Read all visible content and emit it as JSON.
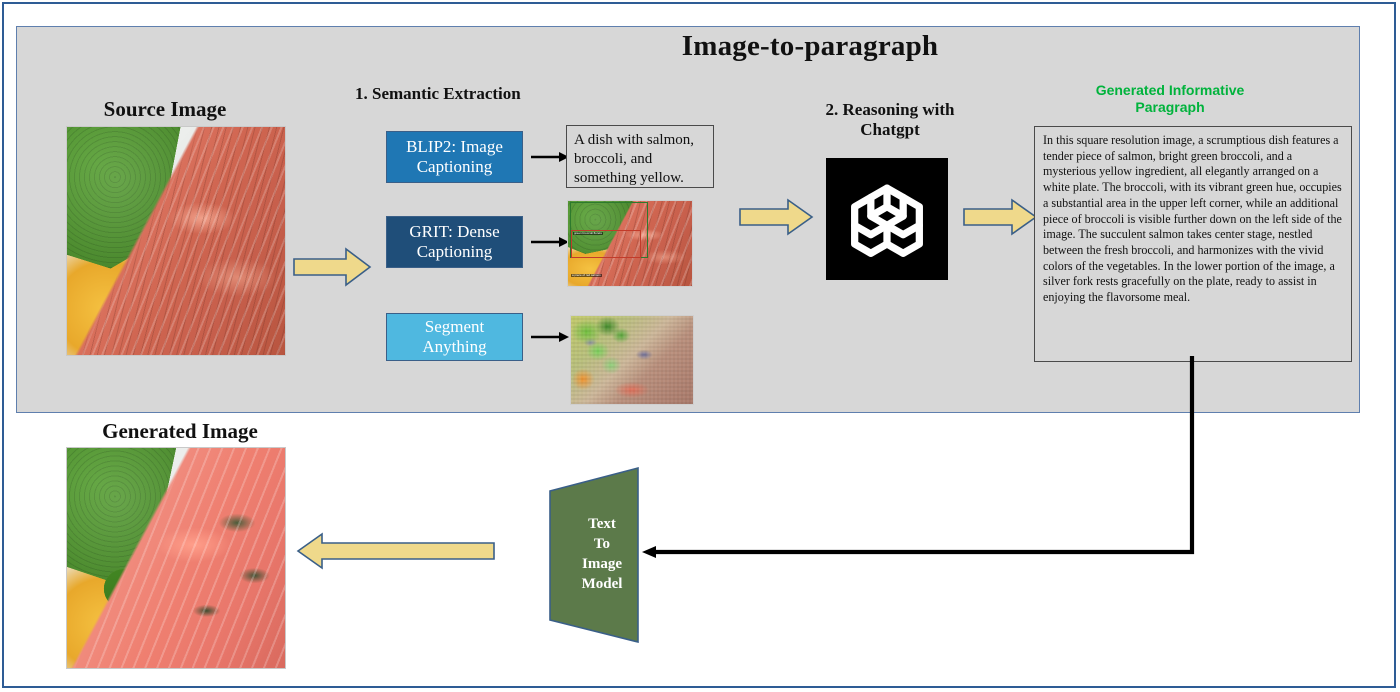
{
  "figure": {
    "title": "Image-to-paragraph",
    "outline_color": "#2e5c95",
    "panel_color": "#d7d7d7"
  },
  "labels": {
    "source_image": "Source Image",
    "generated_image": "Generated Image",
    "step1": "1. Semantic Extraction",
    "step2": "2. Reasoning with\nChatgpt",
    "step2_line1": "2. Reasoning with",
    "step2_line2": "Chatgpt",
    "generated_paragraph_heading": "Generated Informative\nParagraph",
    "generated_paragraph_heading_line1": "Generated Informative",
    "generated_paragraph_heading_line2": "Paragraph",
    "generated_paragraph_heading_color": "#00b33c"
  },
  "modules": [
    {
      "id": "blip2",
      "label": "BLIP2: Image\nCaptioning",
      "line1": "BLIP2: Image",
      "line2": "Captioning",
      "color": "#1f77b4"
    },
    {
      "id": "grit",
      "label": "GRIT: Dense\nCaptioning",
      "line1": "GRIT: Dense",
      "line2": "Captioning",
      "color": "#1f4e79"
    },
    {
      "id": "sam",
      "label": "Segment\nAnything",
      "line1": "Segment",
      "line2": "Anything",
      "color": "#4fb8e0"
    }
  ],
  "outputs": {
    "blip2_caption": "A dish with salmon, broccoli, and something yellow.",
    "grit_boxes": [
      {
        "label": "green broccoli florets",
        "color": "#2d7a2d"
      },
      {
        "label": "a piece of red salmon",
        "color": "#c23b2a"
      }
    ]
  },
  "chatgpt": {
    "logo_name": "openai-logo",
    "background": "#000000",
    "mark_color": "#ffffff"
  },
  "paragraph": {
    "text": "In this square resolution image, a scrumptious dish features a tender piece of salmon, bright green broccoli, and a mysterious yellow ingredient, all elegantly arranged on a white plate. The broccoli, with its vibrant green hue, occupies a substantial area in the upper left corner, while an additional piece of broccoli is visible further down on the left side of the image. The succulent salmon takes center stage, nestled between the fresh broccoli, and harmonizes with the vivid colors of the vegetables. In the lower portion of the image, a silver fork rests gracefully on the plate, ready to assist in enjoying the flavorsome meal."
  },
  "text_to_image_model": {
    "lines": [
      "Text",
      "To",
      "Image",
      "Model"
    ],
    "line1": "Text",
    "line2": "To",
    "line3": "Image",
    "line4": "Model",
    "color": "#5c7a4a"
  },
  "arrows": {
    "yellow_fill": "#efd98b",
    "yellow_stroke": "#3a5f88",
    "black": "#000000",
    "names": [
      "source-to-modules-arrow",
      "extraction-to-chatgpt-arrow",
      "chatgpt-to-paragraph-arrow",
      "model-to-generated-arrow",
      "blip2-output-arrow",
      "grit-output-arrow",
      "sam-output-arrow",
      "paragraph-to-model-connector"
    ]
  }
}
